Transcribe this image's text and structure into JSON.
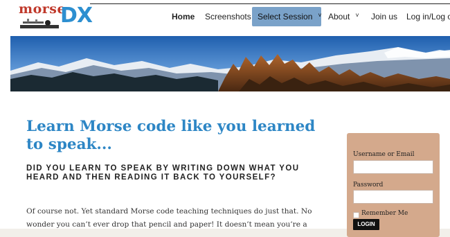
{
  "logo": {
    "word1": "morse",
    "word2": "DX"
  },
  "nav": {
    "home": "Home",
    "screenshots": "Screenshots",
    "select_session": "Select Session",
    "about": "About",
    "join": "Join us",
    "login": "Log in/Log ou",
    "caret": "˅"
  },
  "main": {
    "headline": "Learn Morse code like you learned to speak...",
    "subhead": "DID YOU LEARN TO SPEAK BY WRITING DOWN WHAT YOU HEARD AND THEN READING IT BACK TO YOURSELF?",
    "paragraph": "Of course not. Yet standard Morse code teaching techniques do just that. No wonder you can’t ever drop that pencil and paper! It doesn’t mean you’re a"
  },
  "login_form": {
    "username_label": "Username or Email",
    "password_label": "Password",
    "remember_label": "Remember Me",
    "button_label": "LOGIN"
  },
  "colors": {
    "accent": "#2d86c5",
    "nav_active": "#7aa2c9",
    "login_panel": "#d4a98c",
    "logo_red": "#c0392b"
  }
}
